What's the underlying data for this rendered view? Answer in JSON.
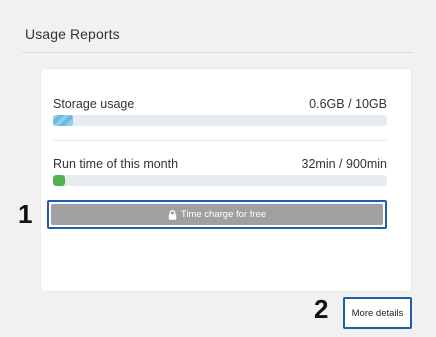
{
  "header": {
    "title": "Usage Reports"
  },
  "storage": {
    "label": "Storage usage",
    "value": "0.6GB / 10GB",
    "fraction": 0.06,
    "color": "#6cb9e5"
  },
  "runtime": {
    "label": "Run time of this month",
    "value": "32min / 900min",
    "fraction": 0.035,
    "color": "#4fb24f"
  },
  "charge_button": {
    "icon": "lock-icon",
    "label": "Time charge for free",
    "color": "#9ea0a2"
  },
  "more_details": {
    "label": "More details"
  },
  "annotations": {
    "marker_1": "1",
    "marker_2": "2",
    "highlight_color": "#1f5ea8"
  }
}
